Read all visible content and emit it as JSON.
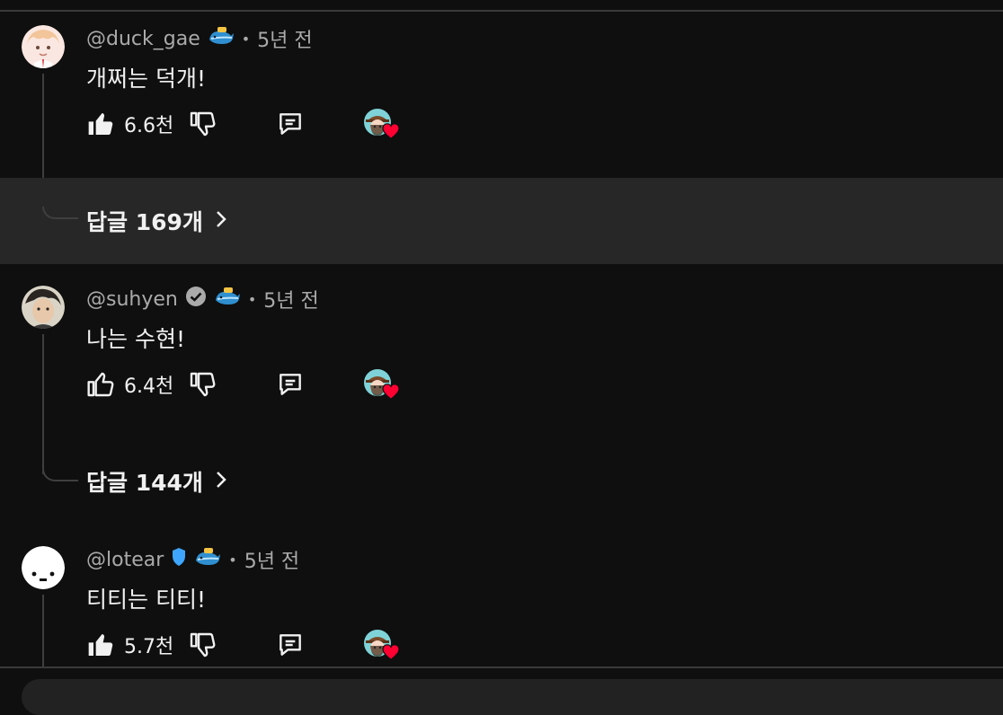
{
  "comments": [
    {
      "handle": "@duck_gae",
      "time": "5년 전",
      "text": "개쩌는 덕개!",
      "likes": "6.6천",
      "replies": "답글 169개",
      "liked": true,
      "verified": false,
      "member_badge": "whale-badge-icon"
    },
    {
      "handle": "@suhyen",
      "time": "5년 전",
      "text": "나는 수현!",
      "likes": "6.4천",
      "replies": "답글 144개",
      "liked": false,
      "verified": true,
      "member_badge": "whale-badge-icon"
    },
    {
      "handle": "@lotear",
      "time": "5년 전",
      "text": "티티는 티티!",
      "likes": "5.7천",
      "liked": true,
      "shield": true,
      "member_badge": "whale-badge-icon"
    }
  ],
  "colors": {
    "background": "#0f0f0f",
    "highlight": "#272727",
    "text": "#f1f1f1",
    "secondary": "#aaaaaa",
    "heart": "#ff0033",
    "shield": "#3ea6ff"
  }
}
